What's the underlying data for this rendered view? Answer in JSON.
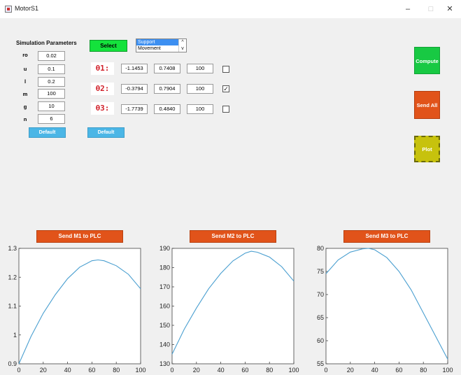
{
  "window": {
    "title": "MotorS1",
    "min": "–",
    "max": "□",
    "close": "✕"
  },
  "simulation": {
    "heading": "Simulation Parameters",
    "params": [
      {
        "label": "ro",
        "value": "0.02"
      },
      {
        "label": "u",
        "value": "0.1"
      },
      {
        "label": "l",
        "value": "0.2"
      },
      {
        "label": "m",
        "value": "100"
      },
      {
        "label": "g",
        "value": "10"
      },
      {
        "label": "n",
        "value": "6"
      }
    ],
    "default_label": "Default"
  },
  "selection": {
    "select_label": "Select",
    "list_options": [
      "Support",
      "Movement"
    ],
    "selected_option": "Support",
    "default_label": "Default"
  },
  "thetas": [
    {
      "label": "θ1:",
      "a": "-1.1453",
      "b": "0.7408",
      "c": "100",
      "checked": false
    },
    {
      "label": "θ2:",
      "a": "-0.3794",
      "b": "0.7904",
      "c": "100",
      "checked": true
    },
    {
      "label": "θ3:",
      "a": "-1.7739",
      "b": "0.4840",
      "c": "100",
      "checked": false
    }
  ],
  "actions": {
    "compute": "Compute",
    "send_all": "Send All",
    "plot": "Plot"
  },
  "send_buttons": [
    "Send M1 to PLC",
    "Send M2 to PLC",
    "Send M3 to PLC"
  ],
  "colors": {
    "line": "#4a9fd0",
    "compute": "#18c943",
    "send": "#e1531a",
    "plot": "#c7c20d"
  },
  "chart_data": [
    {
      "type": "line",
      "title": "",
      "xlabel": "",
      "ylabel": "",
      "xlim": [
        0,
        100
      ],
      "ylim": [
        0.9,
        1.3
      ],
      "xticks": [
        0,
        20,
        40,
        60,
        80,
        100
      ],
      "yticks": [
        0.9,
        1,
        1.1,
        1.2,
        1.3
      ],
      "x": [
        0,
        10,
        20,
        30,
        40,
        50,
        60,
        65,
        70,
        80,
        90,
        100
      ],
      "y": [
        0.9,
        0.995,
        1.075,
        1.14,
        1.195,
        1.235,
        1.257,
        1.26,
        1.257,
        1.24,
        1.21,
        1.16
      ]
    },
    {
      "type": "line",
      "title": "",
      "xlabel": "",
      "ylabel": "",
      "xlim": [
        0,
        100
      ],
      "ylim": [
        130,
        190
      ],
      "xticks": [
        0,
        20,
        40,
        60,
        80,
        100
      ],
      "yticks": [
        130,
        140,
        150,
        160,
        170,
        180,
        190
      ],
      "x": [
        0,
        10,
        20,
        30,
        40,
        50,
        60,
        65,
        70,
        80,
        90,
        100
      ],
      "y": [
        135,
        148,
        159,
        169,
        177,
        183.5,
        187.5,
        188.5,
        188,
        185.5,
        180.5,
        173
      ]
    },
    {
      "type": "line",
      "title": "",
      "xlabel": "",
      "ylabel": "",
      "xlim": [
        0,
        100
      ],
      "ylim": [
        55,
        80
      ],
      "xticks": [
        0,
        20,
        40,
        60,
        80,
        100
      ],
      "yticks": [
        55,
        60,
        65,
        70,
        75,
        80
      ],
      "x": [
        0,
        10,
        20,
        30,
        35,
        40,
        50,
        60,
        70,
        80,
        90,
        100
      ],
      "y": [
        74.5,
        77.5,
        79.2,
        79.9,
        80,
        79.7,
        78,
        75,
        71,
        66,
        61,
        56
      ]
    }
  ]
}
